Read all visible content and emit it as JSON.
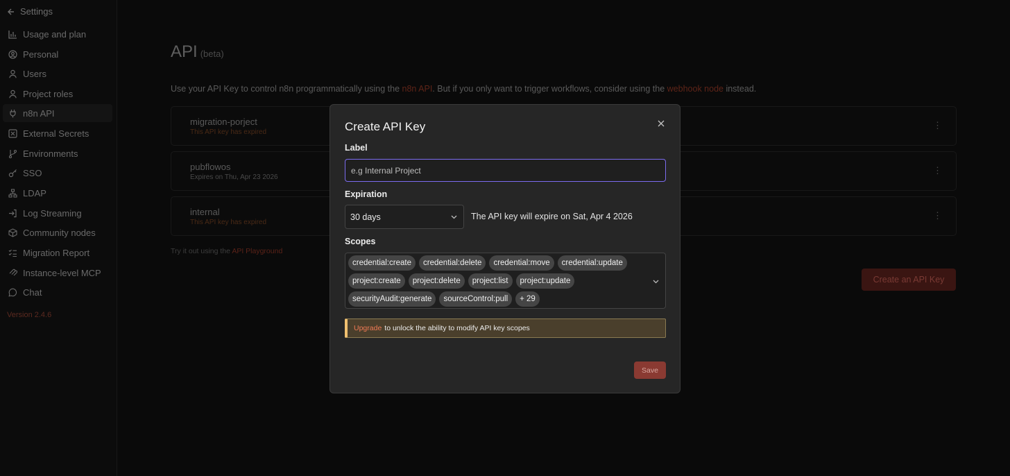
{
  "sidebar": {
    "back_label": "Settings",
    "items": [
      {
        "label": "Usage and plan",
        "icon": "usage-chart-icon"
      },
      {
        "label": "Personal",
        "icon": "user-circle-icon"
      },
      {
        "label": "Users",
        "icon": "user-icon"
      },
      {
        "label": "Project roles",
        "icon": "user-icon"
      },
      {
        "label": "n8n API",
        "icon": "plug-icon",
        "active": true
      },
      {
        "label": "External Secrets",
        "icon": "vault-icon"
      },
      {
        "label": "Environments",
        "icon": "git-branch-icon"
      },
      {
        "label": "SSO",
        "icon": "key-icon"
      },
      {
        "label": "LDAP",
        "icon": "network-icon"
      },
      {
        "label": "Log Streaming",
        "icon": "log-in-icon"
      },
      {
        "label": "Community nodes",
        "icon": "box-icon"
      },
      {
        "label": "Migration Report",
        "icon": "list-checks-icon"
      },
      {
        "label": "Instance-level MCP",
        "icon": "mcp-icon"
      },
      {
        "label": "Chat",
        "icon": "chat-bubble-icon"
      }
    ],
    "version": "Version 2.4.6"
  },
  "page": {
    "title": "API",
    "title_badge": "(beta)",
    "intro_before": "Use your API Key to control n8n programmatically using the ",
    "intro_link1": "n8n API",
    "intro_middle": ". But if you only want to trigger workflows, consider using the ",
    "intro_link2": "webhook node",
    "intro_after": " instead.",
    "keys": [
      {
        "name": "migration-porject",
        "status": "This API key has expired",
        "expired": true
      },
      {
        "name": "pubflowos",
        "status": "Expires on Thu, Apr 23 2026",
        "expired": false
      },
      {
        "name": "internal",
        "status": "This API key has expired",
        "expired": true
      }
    ],
    "tryout_before": "Try it out using the ",
    "tryout_link": "API Playground",
    "create_button": "Create an API Key"
  },
  "modal": {
    "title": "Create API Key",
    "label_field": {
      "label": "Label",
      "placeholder": "e.g Internal Project",
      "value": ""
    },
    "expiration": {
      "label": "Expiration",
      "selected": "30 days",
      "note": "The API key will expire on Sat, Apr 4 2026"
    },
    "scopes": {
      "label": "Scopes",
      "rows": [
        [
          "credential:create",
          "credential:delete",
          "credential:move",
          "credential:update"
        ],
        [
          "project:create",
          "project:delete",
          "project:list",
          "project:update"
        ],
        [
          "securityAudit:generate",
          "sourceControl:pull",
          "+ 29"
        ]
      ]
    },
    "notice": {
      "link": "Upgrade",
      "text": "to unlock the ability to modify API key scopes"
    },
    "save_button": "Save"
  },
  "colors": {
    "accent_focus": "#7c6cf0",
    "primary_button": "#8a3a32",
    "notice_border": "#f0c070",
    "link": "#ef7a55"
  }
}
